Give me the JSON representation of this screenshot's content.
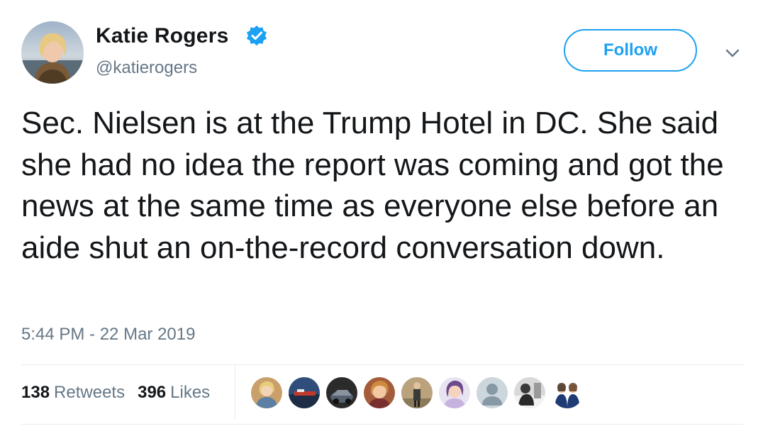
{
  "user": {
    "display_name": "Katie Rogers",
    "handle": "@katierogers",
    "verified": true,
    "avatar_icon": "profile-photo"
  },
  "actions": {
    "follow_label": "Follow",
    "menu_icon": "chevron-down-icon"
  },
  "tweet": {
    "text": "Sec. Nielsen is at the Trump Hotel in DC. She said she had no idea the report was coming and got the news at the same time as everyone else before an aide shut an on-the-record conversation down.",
    "timestamp": "5:44 PM - 22 Mar 2019"
  },
  "stats": {
    "retweets_count": "138",
    "retweets_label": "Retweets",
    "likes_count": "396",
    "likes_label": "Likes"
  },
  "liker_avatars": [
    "liker-avatar-1",
    "liker-avatar-2",
    "liker-avatar-3",
    "liker-avatar-4",
    "liker-avatar-5",
    "liker-avatar-6",
    "liker-avatar-default",
    "liker-avatar-8",
    "liker-avatar-9"
  ],
  "colors": {
    "accent": "#1da1f2",
    "text": "#14171a",
    "secondary_text": "#657786",
    "divider": "#e6ecf0"
  }
}
